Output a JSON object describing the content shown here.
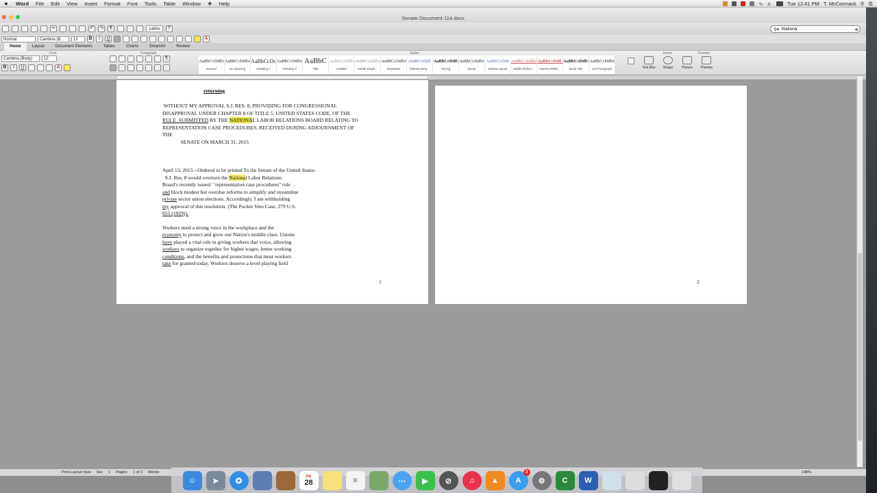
{
  "menubar": {
    "apple": "",
    "items": [
      "Word",
      "File",
      "Edit",
      "View",
      "Insert",
      "Format",
      "Font",
      "Tools",
      "Table",
      "Window",
      "Help"
    ],
    "clock": "Tue 12:41 PM",
    "user": "T. McCormack"
  },
  "window": {
    "title": "Senate Document 114.docx",
    "zoom": "148%"
  },
  "search": {
    "value": "Nationa"
  },
  "format": {
    "style": "Normal",
    "font": "Cambria (B...",
    "size": "12",
    "ribbon_font": "Cambria (Body)",
    "ribbon_size": "12"
  },
  "ribbon": {
    "tabs": [
      "Home",
      "Layout",
      "Document Elements",
      "Tables",
      "Charts",
      "SmartArt",
      "Review"
    ],
    "groups": {
      "font": "Font",
      "paragraph": "Paragraph",
      "styles": "Styles",
      "insert": "Insert",
      "themes": "Themes"
    },
    "styles": [
      {
        "preview": "AaBbCcDdEt",
        "name": "Normal"
      },
      {
        "preview": "AaBbCcDdEe",
        "name": "No Spacing"
      },
      {
        "preview": "AaBbCcDc",
        "name": "Heading 1"
      },
      {
        "preview": "AaBbCcDdEe",
        "name": "Heading 2"
      },
      {
        "preview": "AaBbC",
        "name": "Title"
      },
      {
        "preview": "AaBbCcDdEt",
        "name": "Subtitle"
      },
      {
        "preview": "AaBbCcDdEe",
        "name": "Subtle Emph..."
      },
      {
        "preview": "AaBbCcDdEe",
        "name": "Emphasis"
      },
      {
        "preview": "AaBbCcDdE",
        "name": "Intense Emp..."
      },
      {
        "preview": "AaBbCcDdE",
        "name": "Strong"
      },
      {
        "preview": "AaBbCcDdEe",
        "name": "Quote"
      },
      {
        "preview": "AaBbCcDdE",
        "name": "Intense Quote"
      },
      {
        "preview": "AaBbCcDdEe",
        "name": "Subtle Refere..."
      },
      {
        "preview": "AaBbCcDdE",
        "name": "Intense Refer..."
      },
      {
        "preview": "AaBbCcDdEt",
        "name": "Book Title"
      },
      {
        "preview": "AaBbCcDdEe",
        "name": "List Paragraph"
      }
    ],
    "insert": [
      "Text Box",
      "Shape",
      "Picture"
    ],
    "themes": "Themes"
  },
  "document": {
    "heading_returning": "returning",
    "para1": [
      " WITHOUT MY APPROVAL S.J. RES. 8, PROVIDING FOR CONGRESSIONAL",
      "DISAPPROVAL UNDER CHAPTER 8 OF TITLE 5, UNITED STATES CODE, OF THE",
      "BY THE ",
      "NATIONA",
      "L LABOR RELATIONS BOARD RELATING TO",
      "REPRESENTATION CASE PROCEDURES, RECEIVED DURING ADJOURNMENT OF",
      "THE",
      "              SENATE ON MARCH 31, 2015"
    ],
    "rule_submitted": "RULE  SUBMITTED",
    "para2": {
      "line1": "April 13, 2015.--Ordered to be printed To the Senate of the United States:",
      "line2a": "  S.J. Res. 8 would overturn the ",
      "line2hl": "Nationa",
      "line2b": "l Labor Relations",
      "line3": "Board's recently issued ``representation case procedures'' rule",
      "line4u": "and",
      "line4": " block modest but overdue reforms to simplify and streamline",
      "line5u": "private",
      "line5": " sector union elections. Accordingly, I am withholding",
      "line6u": "my",
      "line6": " approval of this resolution. (The Pocket Veto Case, 279 U.S.",
      "line7u": "655 (1929))."
    },
    "para3": {
      "line1": "Workers need a strong voice in the workplace and the",
      "line2u": "economy",
      "line2": " to protect and grow our Nation's middle class. Unions",
      "line3u": "have",
      "line3": " played a vital role in giving workers that voice, allowing",
      "line4u": "workers",
      "line4": " to organize together for higher wages, better working",
      "line5u": "conditions",
      "line5": ", and the benefits and protections that most workers",
      "line6u": "take",
      "line6": " for granted today. Workers deserve a level playing field"
    },
    "page1_number": "1",
    "page2_number": "2"
  },
  "status": {
    "view": "Print Layout View",
    "sec": "Sec",
    "sec_val": "1",
    "pages": "Pages:",
    "pages_val": "1 of 2",
    "words": "Words:",
    "zoom": "148%"
  },
  "dock": {
    "calendar_day": "28",
    "calendar_month": "JUL",
    "appstore_badge": "3"
  }
}
